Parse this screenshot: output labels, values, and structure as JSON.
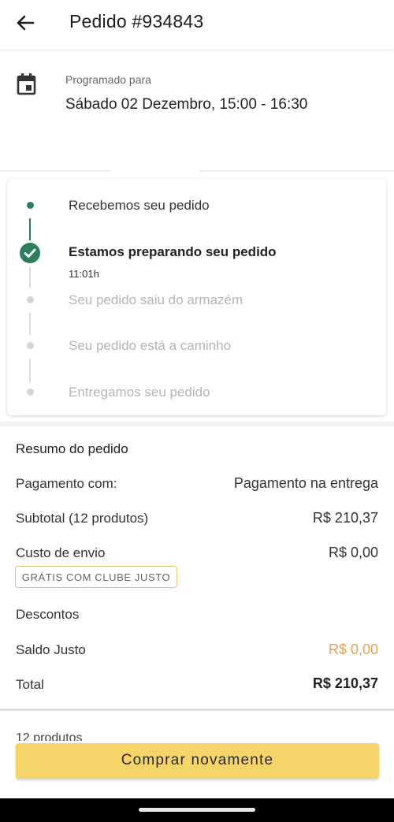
{
  "header": {
    "title": "Pedido #934843",
    "back_icon": "arrow-left-icon"
  },
  "schedule": {
    "label": "Programado para",
    "value": "Sábado 02 Dezembro, 15:00 - 16:30",
    "icon": "calendar-icon"
  },
  "tracking": {
    "steps": [
      {
        "label": "Recebemos seu pedido",
        "state": "done"
      },
      {
        "label": "Estamos preparando seu pedido",
        "state": "current",
        "time": "11:01h"
      },
      {
        "label": "Seu pedido saiu do armazém",
        "state": "pending"
      },
      {
        "label": "Seu pedido está a caminho",
        "state": "pending"
      },
      {
        "label": "Entregamos seu pedido",
        "state": "pending"
      }
    ],
    "colors": {
      "active": "#2e7d5b",
      "inactive": "#d4d4d4",
      "inactive_text": "#b5b5b5"
    }
  },
  "summary": {
    "title": "Resumo do pedido",
    "payment_label": "Pagamento com:",
    "payment_value": "Pagamento na entrega",
    "subtotal_label": "Subtotal (12 produtos)",
    "subtotal_value": "R$ 210,37",
    "shipping_label": "Custo de envio",
    "shipping_value": "R$ 0,00",
    "shipping_badge": "GRÁTIS COM CLUBE JUSTO",
    "discounts_label": "Descontos",
    "balance_label": "Saldo Justo",
    "balance_value": "R$ 0,00",
    "total_label": "Total",
    "total_value": "R$ 210,37"
  },
  "products_peek": "12 produtos",
  "buy_again_label": "Comprar novamente",
  "colors": {
    "accent_yellow": "#f6d46a",
    "orange_value": "#e9a050",
    "green": "#2e7d5b"
  }
}
